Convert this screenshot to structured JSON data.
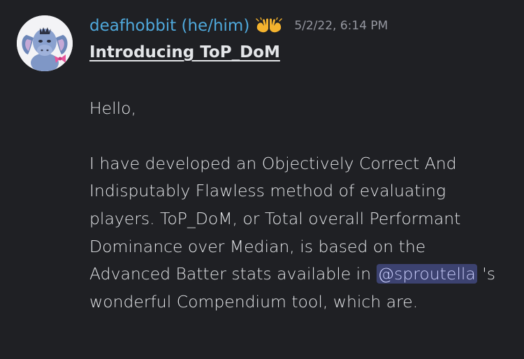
{
  "message": {
    "author": "deafhobbit (he/him)",
    "role_icon": "raising-hands-icon",
    "timestamp": "5/2/22, 6:14 PM",
    "title": "Introducing ToP_DoM",
    "greeting": "Hello,",
    "body_before_mention": "I have developed an Objectively Correct And Indisputably Flawless method of evaluating players. ToP_DoM, or Total overall Performant Dominance over Median, is based on the Advanced Batter stats available in ",
    "mention": "@sproutella",
    "body_after_mention": " 's wonderful Compendium tool, which are."
  },
  "colors": {
    "background": "#1f2024",
    "username": "#4fa9dc",
    "timestamp": "#9597a0",
    "mention_bg": "#3c4270",
    "mention_text": "#c9cdfb"
  }
}
